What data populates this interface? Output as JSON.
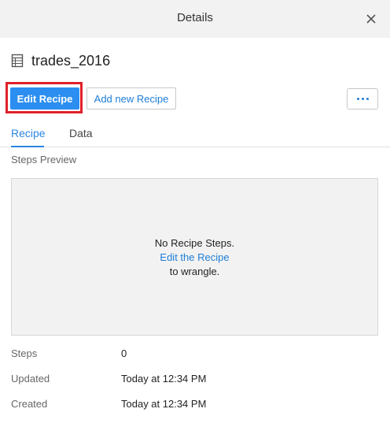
{
  "header": {
    "title": "Details"
  },
  "dataset": {
    "name": "trades_2016",
    "icon": "table-icon"
  },
  "actions": {
    "edit_recipe": "Edit Recipe",
    "add_recipe": "Add new Recipe",
    "more_icon": "ellipsis-icon"
  },
  "tabs": [
    {
      "label": "Recipe",
      "active": true
    },
    {
      "label": "Data",
      "active": false
    }
  ],
  "preview": {
    "section_label": "Steps Preview",
    "line1": "No Recipe Steps.",
    "link": "Edit the Recipe",
    "line3": "to wrangle."
  },
  "meta": {
    "steps_label": "Steps",
    "steps_value": "0",
    "updated_label": "Updated",
    "updated_value": "Today at 12:34 PM",
    "created_label": "Created",
    "created_value": "Today at 12:34 PM"
  },
  "colors": {
    "primary": "#2b8ef0",
    "link": "#1e7ed8",
    "highlight": "#e0202a"
  }
}
